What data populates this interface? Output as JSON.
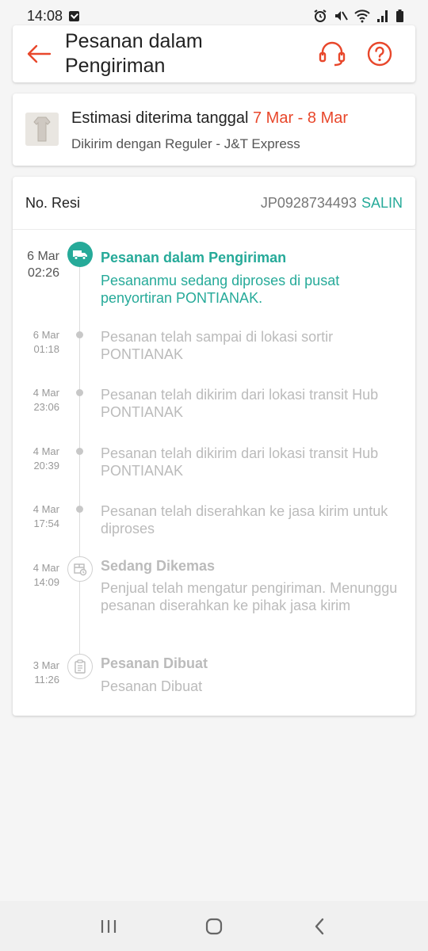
{
  "status": {
    "time": "14:08"
  },
  "header": {
    "title": "Pesanan dalam Pengiriman",
    "accent": "#e8472b"
  },
  "estimate": {
    "prefix": "Estimasi diterima tanggal",
    "date_range": "7 Mar - 8 Mar",
    "shipping": "Dikirim dengan Reguler - J&T Express"
  },
  "resi": {
    "label": "No. Resi",
    "number": "JP0928734493",
    "copy_label": "SALIN"
  },
  "timeline": [
    {
      "day": "6 Mar",
      "time": "02:26",
      "title": "Pesanan dalam Pengiriman",
      "desc": "Pesananmu sedang diproses di pusat penyortiran PONTIANAK.",
      "icon": "truck-icon"
    },
    {
      "day": "6 Mar",
      "time": "01:18",
      "title": "",
      "desc": "Pesanan telah sampai di lokasi sortir PONTIANAK",
      "icon": "dot"
    },
    {
      "day": "4 Mar",
      "time": "23:06",
      "title": "",
      "desc": "Pesanan telah dikirim dari lokasi transit Hub PONTIANAK",
      "icon": "dot"
    },
    {
      "day": "4 Mar",
      "time": "20:39",
      "title": "",
      "desc": "Pesanan telah dikirim dari lokasi transit Hub PONTIANAK",
      "icon": "dot"
    },
    {
      "day": "4 Mar",
      "time": "17:54",
      "title": "",
      "desc": "Pesanan telah diserahkan ke jasa kirim untuk diproses",
      "icon": "dot"
    },
    {
      "day": "4 Mar",
      "time": "14:09",
      "title": "Sedang Dikemas",
      "desc": "Penjual telah mengatur pengiriman. Menunggu pesanan diserahkan ke pihak jasa kirim",
      "icon": "package-icon"
    },
    {
      "day": "3 Mar",
      "time": "11:26",
      "title": "Pesanan Dibuat",
      "desc": "Pesanan Dibuat",
      "icon": "clipboard-icon"
    }
  ],
  "colors": {
    "teal": "#26aa99",
    "orange": "#e8472b",
    "muted": "#bbbbbb"
  }
}
